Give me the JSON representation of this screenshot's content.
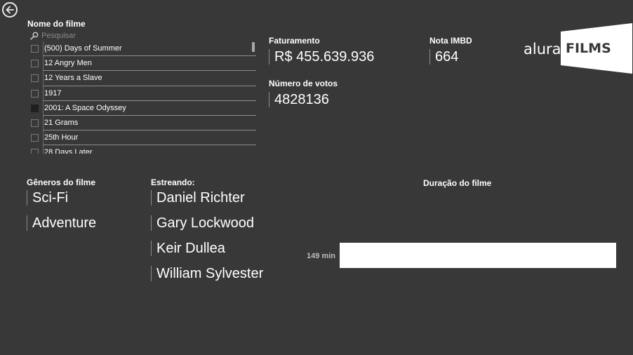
{
  "nav": {
    "back_icon": "arrow-left-circle-icon"
  },
  "slicer": {
    "title": "Nome do filme",
    "search_placeholder": "Pesquisar",
    "search_icon": "search-icon",
    "items": [
      {
        "label": "(500) Days of Summer",
        "checked": false
      },
      {
        "label": "12 Angry Men",
        "checked": false
      },
      {
        "label": "12 Years a Slave",
        "checked": false
      },
      {
        "label": "1917",
        "checked": false
      },
      {
        "label": "2001: A Space Odyssey",
        "checked": true
      },
      {
        "label": "21 Grams",
        "checked": false
      },
      {
        "label": "25th Hour",
        "checked": false
      },
      {
        "label": "28 Days Later",
        "checked": false
      }
    ]
  },
  "kpis": {
    "revenue": {
      "title": "Faturamento",
      "value": "R$ 455.639.936"
    },
    "rating": {
      "title": "Nota IMBD",
      "value": "664"
    },
    "votes": {
      "title": "Número de votos",
      "value": "4828136"
    }
  },
  "logo": {
    "text_light": "alura",
    "text_bold": "FILMS"
  },
  "genres": {
    "title": "Gêneros do filme",
    "items": [
      "Sci-Fi",
      "Adventure"
    ]
  },
  "cast": {
    "title": "Estreando:",
    "items": [
      "Daniel Richter",
      "Gary Lockwood",
      "Keir Dullea",
      "William Sylvester"
    ]
  },
  "chart_data": {
    "type": "bar",
    "title": "Duração do filme",
    "categories": [
      ""
    ],
    "values": [
      149
    ],
    "data_labels": [
      "149 min"
    ],
    "xlim": [
      0,
      149
    ],
    "bar_color": "#ffffff",
    "grid": false
  },
  "colors": {
    "background": "#383838",
    "text": "#ffffff",
    "bar": "#ffffff"
  }
}
